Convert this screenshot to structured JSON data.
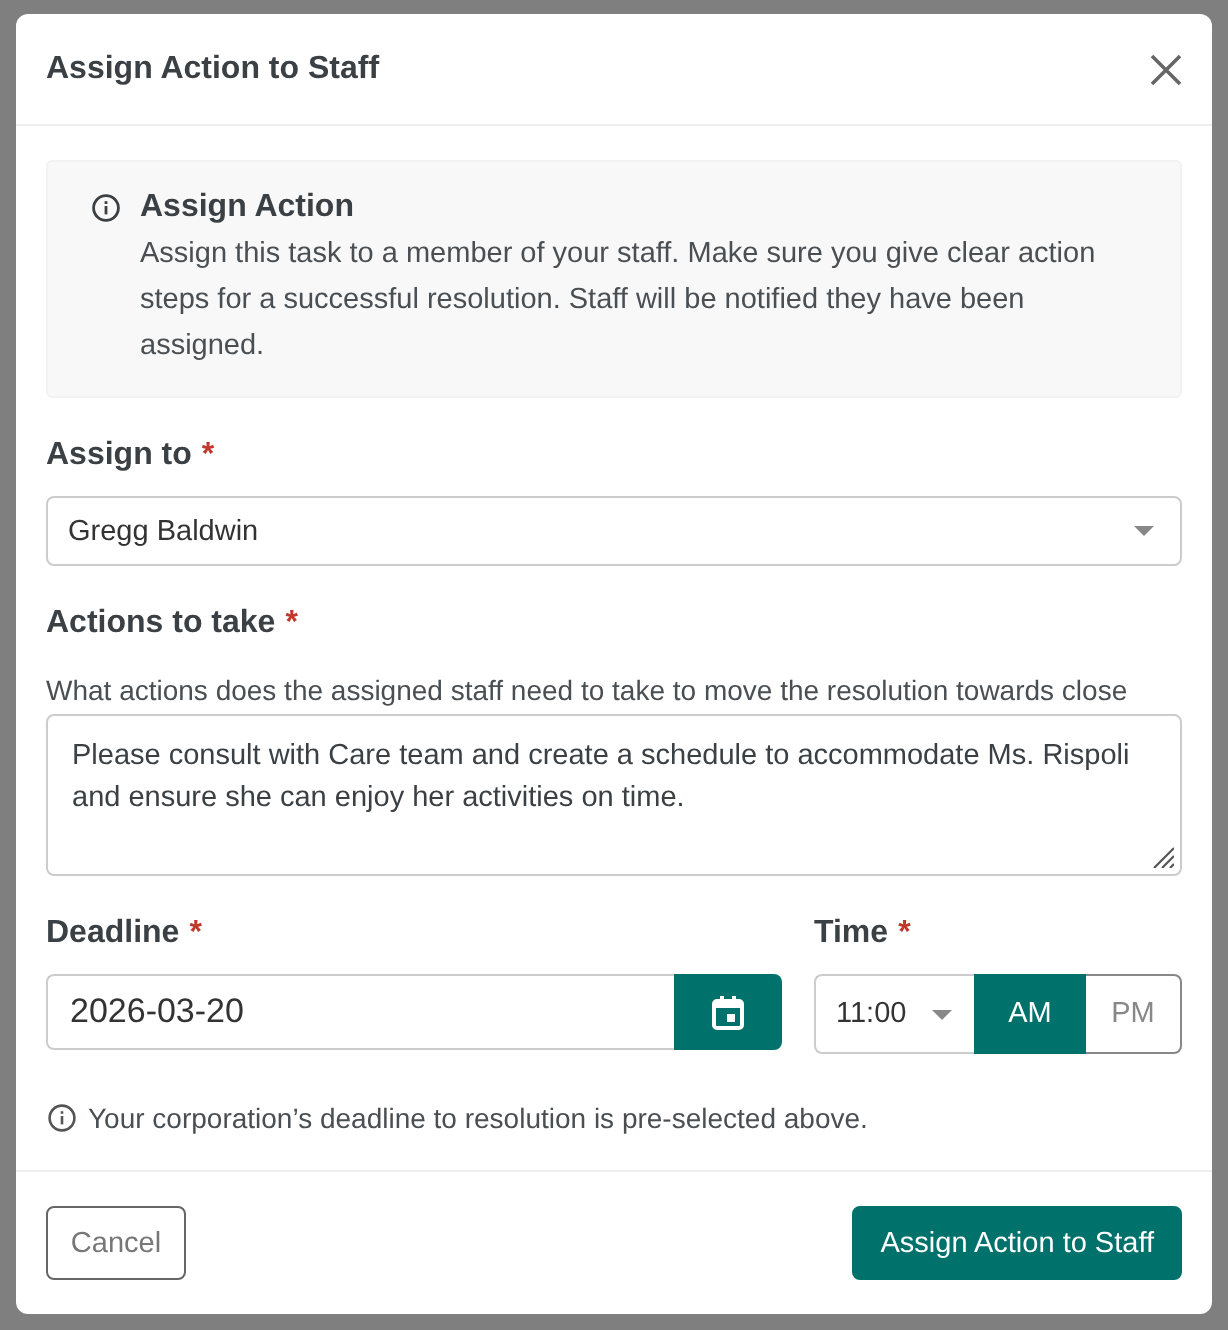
{
  "dialog": {
    "title": "Assign Action to Staff"
  },
  "info_box": {
    "title": "Assign Action",
    "text": "Assign this task to a member of your staff. Make sure you give clear action steps for a successful resolution. Staff will be notified they have been assigned."
  },
  "assign_to": {
    "label": "Assign to",
    "required_mark": "*",
    "value": "Gregg Baldwin"
  },
  "actions": {
    "label": "Actions to take",
    "required_mark": "*",
    "hint": "What actions does the assigned staff need to take to move the resolution towards close",
    "value": "Please consult with Care team and create a schedule to accommodate Ms. Rispoli and ensure she can enjoy her activities on time."
  },
  "deadline": {
    "label": "Deadline",
    "required_mark": "*",
    "value": "2026-03-20"
  },
  "time": {
    "label": "Time",
    "required_mark": "*",
    "value": "11:00",
    "periods": [
      {
        "label": "AM",
        "selected": true
      },
      {
        "label": "PM",
        "selected": false
      }
    ]
  },
  "note": "Your corporation’s deadline to resolution is pre-selected above.",
  "buttons": [
    {
      "label": "Cancel",
      "kind": "secondary"
    },
    {
      "label": "Assign Action to Staff",
      "kind": "primary"
    }
  ]
}
